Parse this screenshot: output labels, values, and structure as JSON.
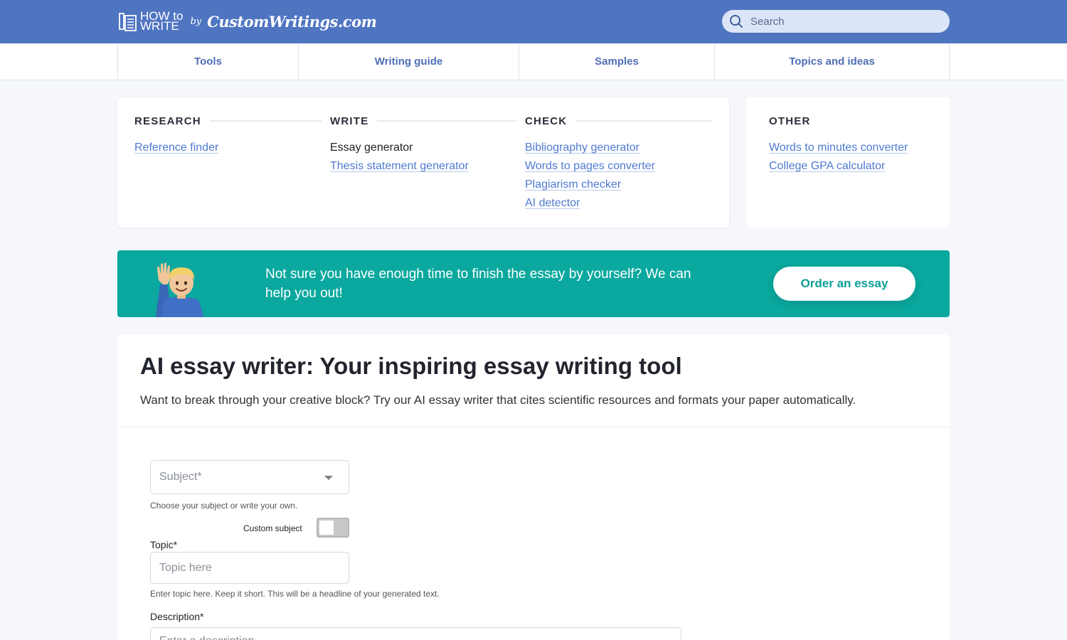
{
  "header": {
    "logo_how": "HOW to",
    "logo_write": "WRITE",
    "logo_by": "by",
    "logo_brand": "CustomWritings.com",
    "search_placeholder": "Search"
  },
  "nav": {
    "items": [
      {
        "label": "Tools"
      },
      {
        "label": "Writing guide"
      },
      {
        "label": "Samples"
      },
      {
        "label": "Topics and ideas"
      }
    ]
  },
  "tools": {
    "research": {
      "title": "RESEARCH",
      "links": [
        "Reference finder"
      ]
    },
    "write": {
      "title": "WRITE",
      "links": [
        "Essay generator",
        "Thesis statement generator"
      ]
    },
    "check": {
      "title": "CHECK",
      "links": [
        "Bibliography generator",
        "Words to pages converter",
        "Plagiarism checker",
        "AI detector"
      ]
    },
    "other": {
      "title": "OTHER",
      "links": [
        "Words to minutes converter",
        "College GPA calculator"
      ]
    }
  },
  "banner": {
    "text": "Not sure you have enough time to finish the essay by yourself? We can help you out!",
    "button": "Order an essay"
  },
  "main": {
    "title": "AI essay writer: Your inspiring essay writing tool",
    "subtitle": "Want to break through your creative block? Try our AI essay writer that cites scientific resources and formats your paper automatically.",
    "subject_placeholder": "Subject*",
    "subject_hint": "Choose your subject or write your own.",
    "custom_subject_label": "Custom subject",
    "topic_label": "Topic*",
    "topic_placeholder": "Topic here",
    "topic_hint": "Enter topic here. Keep it short. This will be a headline of your generated text.",
    "description_label": "Description*",
    "description_placeholder": "Enter a description"
  },
  "colors": {
    "header": "#4f75c1",
    "link": "#4f7ad1",
    "banner": "#0aa89e"
  }
}
